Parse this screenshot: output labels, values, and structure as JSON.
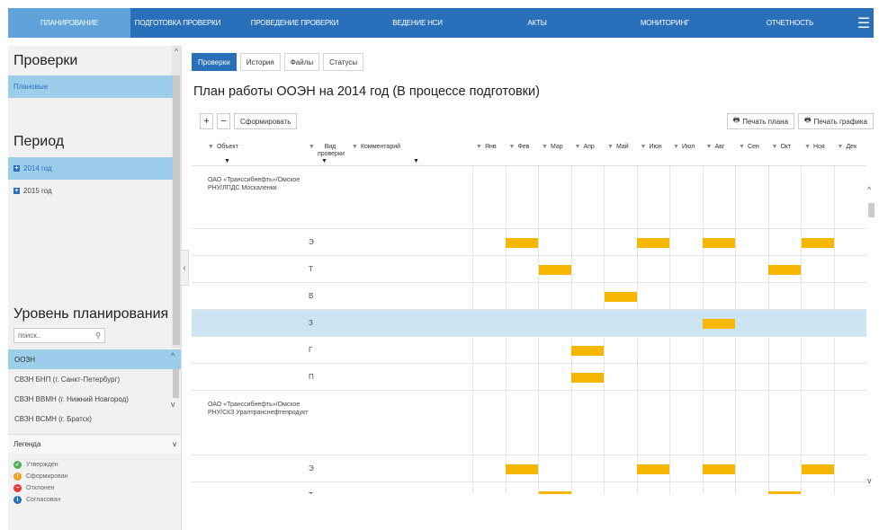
{
  "nav": {
    "items": [
      "ПЛАНИРОВАНИЕ",
      "ПОДГОТОВКА ПРОВЕРКИ",
      "ПРОВЕДЕНИЕ ПРОВЕРКИ",
      "ВЕДЕНИЕ НСИ",
      "АКТЫ",
      "МОНИТОРИНГ",
      "ОТЧЕТНОСТЬ"
    ],
    "menu_icon": "hamburger-icon"
  },
  "left": {
    "checks_title": "Проверки",
    "checks_items": [
      "Плановые"
    ],
    "period_title": "Период",
    "period_items": [
      "2014 год",
      "2015 год"
    ],
    "level_title": "Уровень планирования",
    "search_placeholder": "поиск..",
    "levels": [
      "ООЗН",
      "СВЗН БНП (г. Санкт-Петербург)",
      "СВЗН ВВМН (г. Нижний Новгород)",
      "СВЗН ВСМН (г. Братск)"
    ],
    "legend_title": "Легенда",
    "legend": [
      {
        "label": "Утвержден",
        "color": "#4caf50"
      },
      {
        "label": "Сформирован",
        "color": "#f0a020"
      },
      {
        "label": "Отклонен",
        "color": "#e53935"
      },
      {
        "label": "Согласован",
        "color": "#2a6fba"
      }
    ]
  },
  "tabs": [
    "Проверки",
    "История",
    "Файлы",
    "Статусы"
  ],
  "title": "План работы ООЭН на 2014 год (В процессе подготовки)",
  "toolbar": {
    "add": "+",
    "remove": "−",
    "generate": "Сформировать",
    "print_plan": "Печать плана",
    "print_schedule": "Печать графика"
  },
  "columns": {
    "object": "Объект",
    "type": "Вид проверки",
    "comment": "Комментарий",
    "months": [
      "Янв",
      "Фев",
      "Мар",
      "Апр",
      "Май",
      "Июн",
      "Июл",
      "Авг",
      "Сен",
      "Окт",
      "Ноя",
      "Дек"
    ]
  },
  "rows": [
    {
      "object": "ОАО «Транссибнефть»/Омское РНУ/ЛПДС Москаленки",
      "type": "",
      "months": []
    },
    {
      "object": "",
      "type": "Э",
      "months": [
        2,
        6,
        8,
        11
      ]
    },
    {
      "object": "",
      "type": "Т",
      "months": [
        3,
        10
      ]
    },
    {
      "object": "",
      "type": "В",
      "months": [
        5
      ]
    },
    {
      "object": "",
      "type": "З",
      "months": [
        8
      ],
      "selected": true
    },
    {
      "object": "",
      "type": "Г",
      "months": [
        4
      ]
    },
    {
      "object": "",
      "type": "П",
      "months": [
        4
      ]
    },
    {
      "object": "ОАО «Транссибнефть»/Омское РНУ/СКЗ Уралтранснефтепродукт",
      "type": "",
      "months": []
    },
    {
      "object": "",
      "type": "Э",
      "months": [
        2,
        6,
        8,
        11
      ]
    },
    {
      "object": "",
      "type": "Т",
      "months": [
        3,
        10
      ]
    }
  ]
}
